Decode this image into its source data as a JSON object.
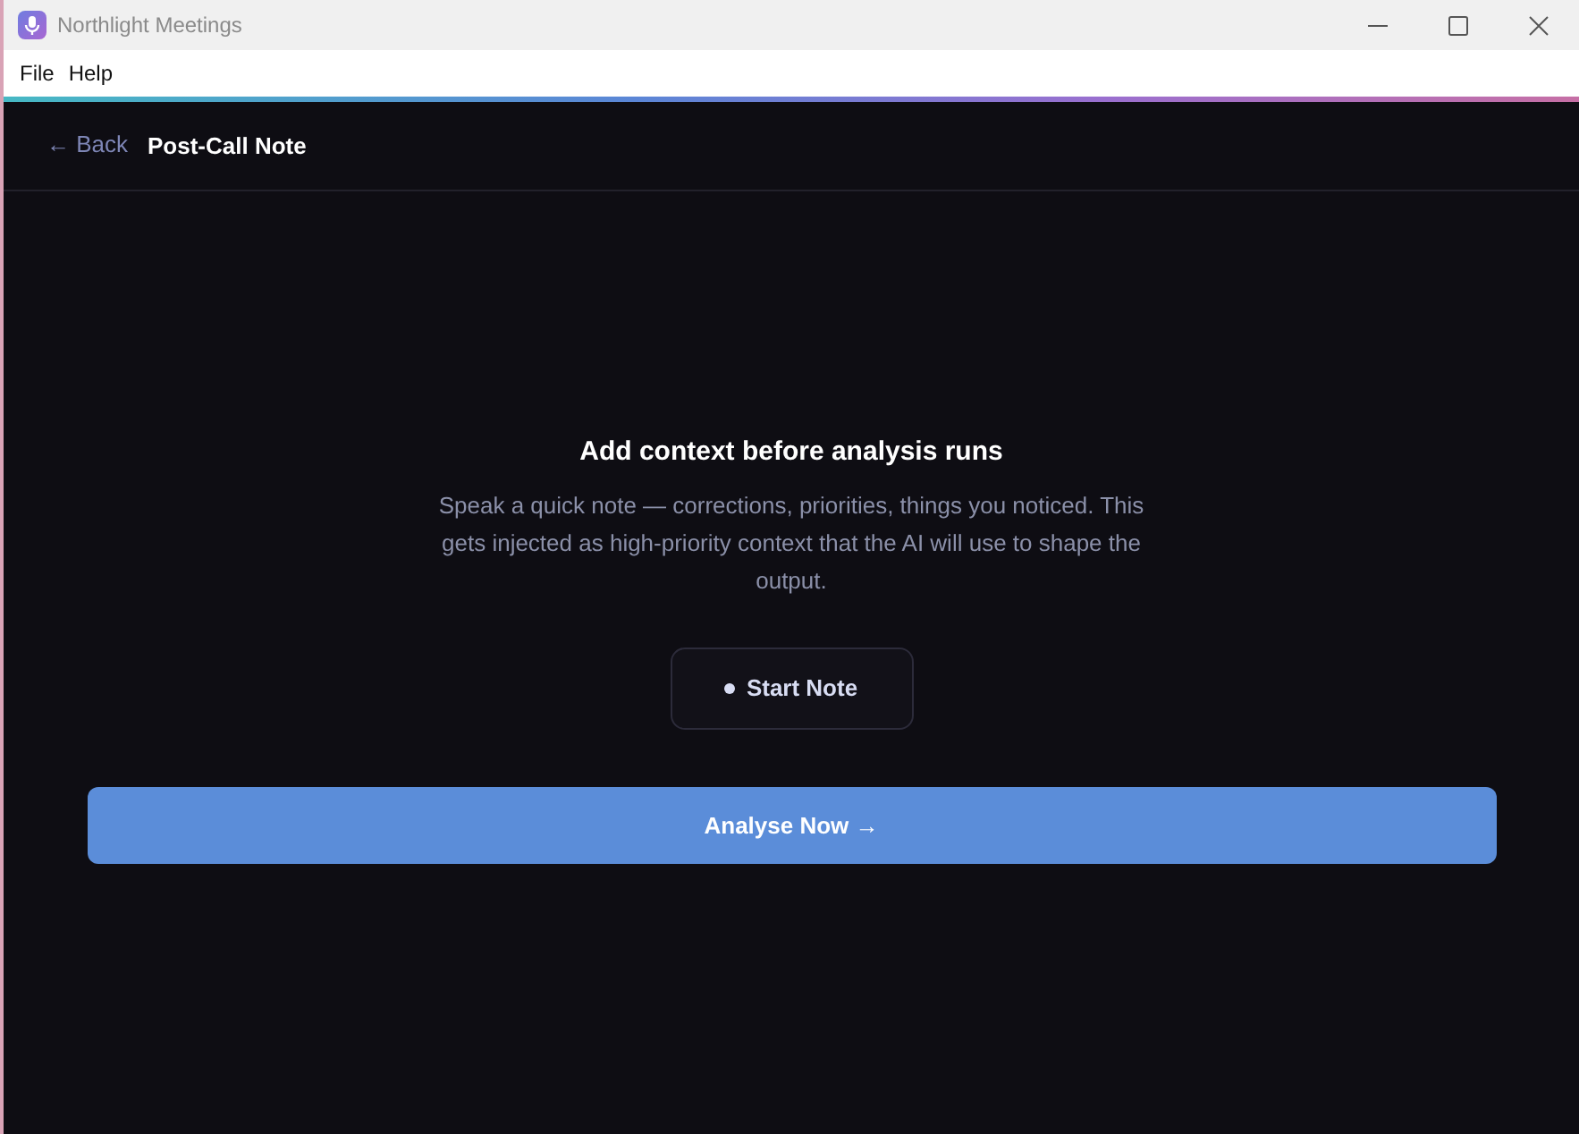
{
  "window": {
    "title": "Northlight Meetings"
  },
  "menu": [
    {
      "label": "File"
    },
    {
      "label": "Help"
    }
  ],
  "header": {
    "back": "← Back",
    "title": "Post-Call Note"
  },
  "prompt": {
    "heading": "Add context before analysis runs",
    "body": "Speak a quick note — corrections, priorities, things you noticed. This gets injected as high-priority context that the AI will use to shape the output."
  },
  "note_button": {
    "label": "Start Note"
  },
  "primary_button": {
    "label": "Analyse Now →"
  }
}
